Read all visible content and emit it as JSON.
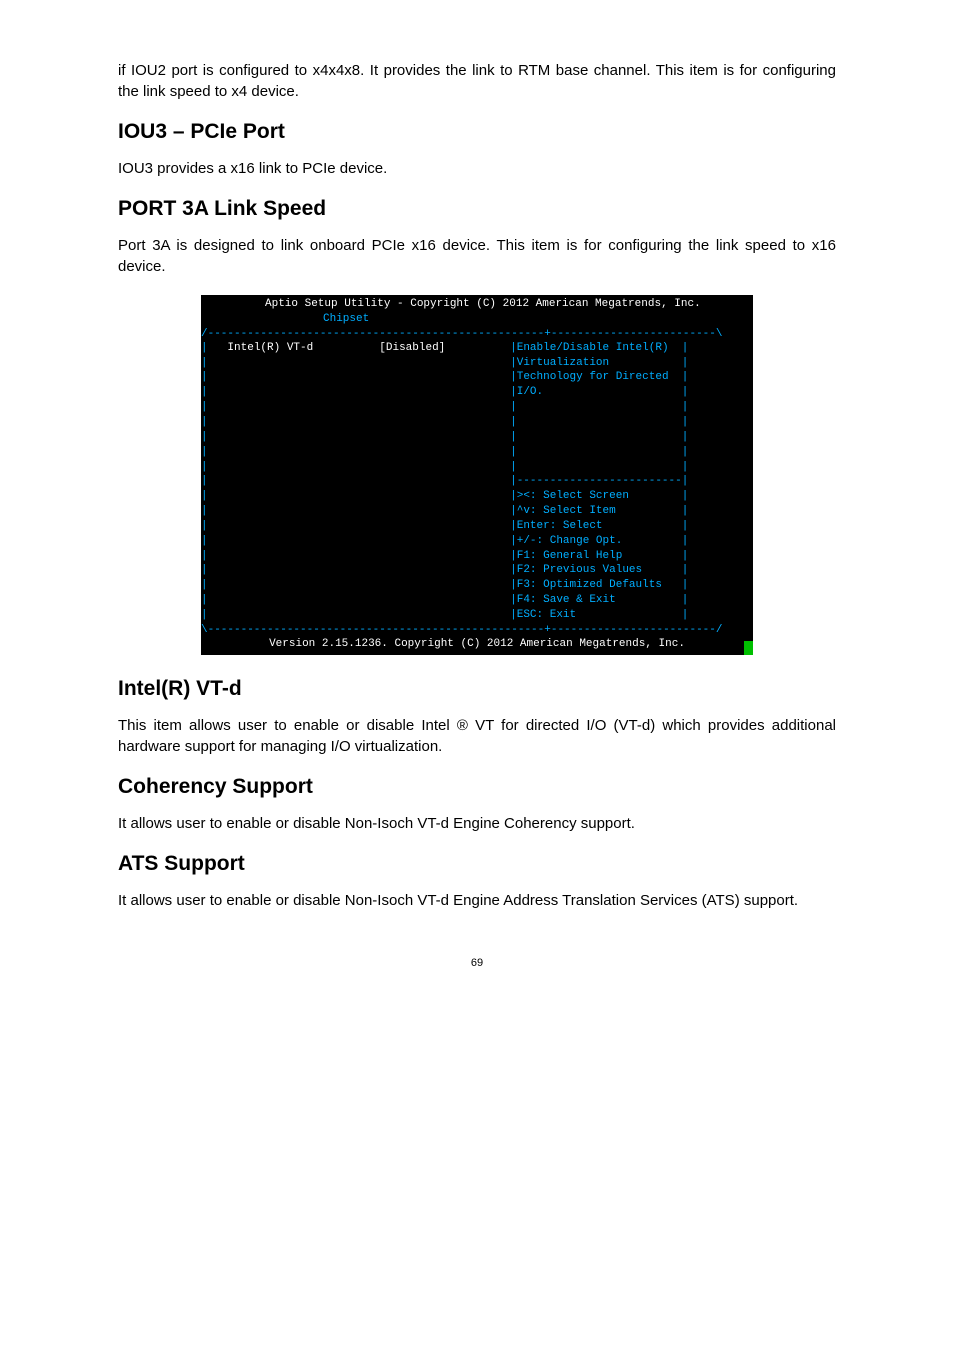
{
  "paragraphs": {
    "p1": "if IOU2 port is configured to x4x4x8. It provides the link to RTM base channel. This item is for configuring the link speed to x4 device.",
    "p2": "IOU3 provides a x16 link to PCIe device.",
    "p3": "Port 3A is designed to link onboard PCIe x16 device. This item is for configuring the link speed to x16 device.",
    "p4": "This item allows user to enable or disable Intel ® VT for directed I/O (VT-d) which provides additional hardware support for managing I/O virtualization.",
    "p5": "It allows user to enable or disable Non-Isoch VT-d Engine Coherency support.",
    "p6": "It allows user to enable or disable Non-Isoch VT-d Engine Address Translation Services (ATS) support."
  },
  "headings": {
    "h1": "IOU3 – PCIe Port",
    "h2": "PORT 3A Link Speed",
    "h3": "Intel(R) VT-d",
    "h4": "Coherency Support",
    "h5": "ATS Support"
  },
  "bios": {
    "header_line1": "Aptio Setup Utility - Copyright (C) 2012 American Megatrends, Inc.",
    "header_line2": "Chipset",
    "top_divider": "/---------------------------------------------------+-------------------------\\",
    "left_col": {
      "item": "Intel(R) VT-d",
      "value": "[Disabled]"
    },
    "help": {
      "l1": "Enable/Disable Intel(R)",
      "l2": "Virtualization",
      "l3": "Technology for Directed",
      "l4": "I/O."
    },
    "right_div": "|-------------------------",
    "keys": {
      "k1": "><: Select Screen",
      "k2": "^v: Select Item",
      "k3": "Enter: Select",
      "k4": "+/-: Change Opt.",
      "k5": "F1: General Help",
      "k6": "F2: Previous Values",
      "k7": "F3: Optimized Defaults",
      "k8": "F4: Save & Exit",
      "k9": "ESC: Exit"
    },
    "bottom_divider": "\\---------------------------------------------------+-------------------------/",
    "footer": "Version 2.15.1236. Copyright (C) 2012 American Megatrends, Inc."
  },
  "page_number": "69"
}
